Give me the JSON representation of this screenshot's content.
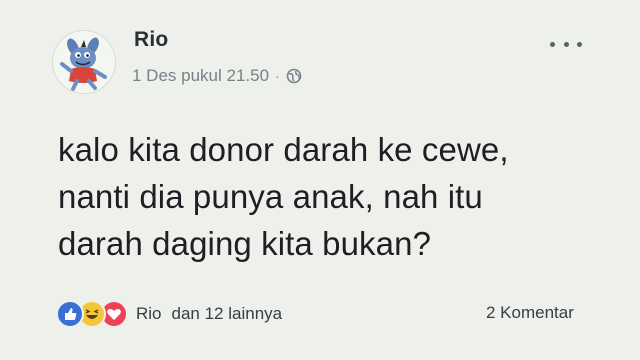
{
  "post": {
    "author": "Rio",
    "timestamp": "1 Des pukul 21.50",
    "separator": "·",
    "privacy_icon": "globe-icon",
    "more_icon": "more-options-icon",
    "text_lines": [
      "kalo kita donor darah ke cewe,",
      "nanti dia punya anak, nah itu",
      "darah daging kita bukan?"
    ]
  },
  "reactions": {
    "icons": [
      "like-icon",
      "haha-icon",
      "love-icon"
    ],
    "first_name": "Rio",
    "others": "dan 12 lainnya",
    "comments": "2 Komentar"
  },
  "colors": {
    "background": "#eef0ec",
    "like": "#3b6fd4",
    "haha": "#f4c63a",
    "love": "#ee4357"
  }
}
